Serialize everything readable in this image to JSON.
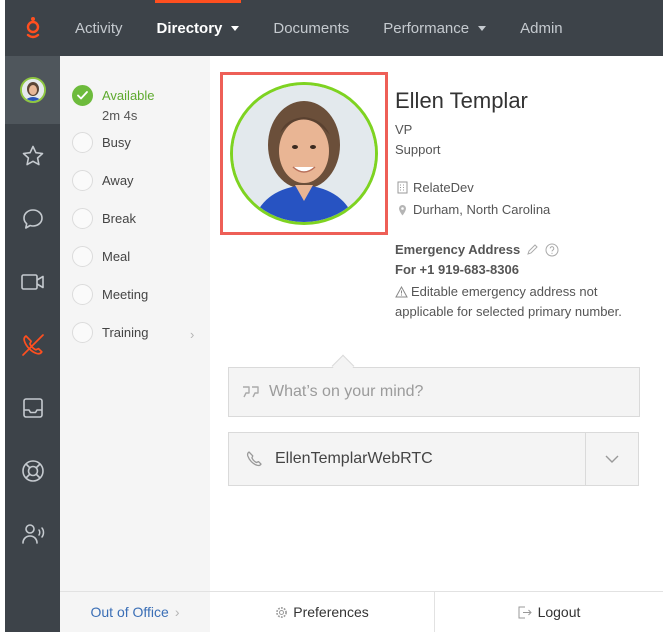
{
  "nav": {
    "items": [
      {
        "label": "Activity",
        "dropdown": false,
        "active": false
      },
      {
        "label": "Directory",
        "dropdown": true,
        "active": true
      },
      {
        "label": "Documents",
        "dropdown": false,
        "active": false
      },
      {
        "label": "Performance",
        "dropdown": true,
        "active": false
      },
      {
        "label": "Admin",
        "dropdown": false,
        "active": false
      }
    ],
    "accent_color": "#ff4f1f",
    "logo_icon": "genesys-logo-icon"
  },
  "rail": {
    "items": [
      "avatar",
      "star-icon",
      "chat-bubble-icon",
      "video-icon",
      "phone-off-icon",
      "inbox-icon",
      "lifebuoy-icon",
      "people-speaking-icon"
    ]
  },
  "status": {
    "available_label": "Available",
    "timer": "2m 4s",
    "items": [
      "Busy",
      "Away",
      "Break",
      "Meal",
      "Meeting",
      "Training"
    ]
  },
  "profile": {
    "name": "Ellen Templar",
    "title": "VP",
    "department": "Support",
    "organization": "RelateDev",
    "location": "Durham, North Carolina",
    "emergency_heading": "Emergency Address",
    "emergency_for": "For +1 919-683-8306",
    "emergency_note": "Editable emergency address not applicable for selected primary number."
  },
  "post": {
    "placeholder": "What’s on your mind?"
  },
  "phone": {
    "selected": "EllenTemplarWebRTC"
  },
  "footer": {
    "out_of_office": "Out of Office",
    "preferences": "Preferences",
    "logout": "Logout"
  },
  "colors": {
    "status_green": "#6dbb3c",
    "highlight_red": "#ee5f57",
    "link_blue": "#3b6fb6"
  }
}
